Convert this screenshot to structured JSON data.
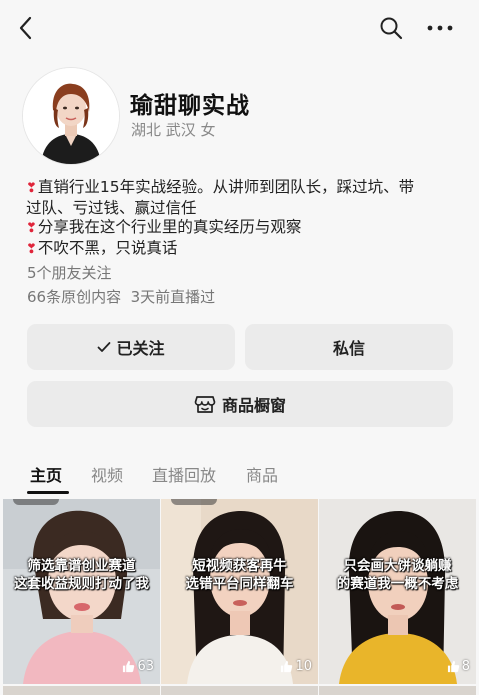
{
  "profile": {
    "name": "瑜甜聊实战",
    "location": "湖北 武汉 女",
    "bio_lines": [
      "直销行业15年实战经验。从讲师到团队长，踩过坑、带",
      "过队、亏过钱、赢过信任",
      "分享我在这个行业里的真实经历与观察",
      "不吹不黑，只说真话"
    ],
    "friends_following": "5个朋友关注",
    "stats_line": "66条原创内容  3天前直播过"
  },
  "actions": {
    "follow_label": "已关注",
    "message_label": "私信",
    "shop_label": "商品橱窗"
  },
  "tabs": [
    "主页",
    "视频",
    "直播回放",
    "商品"
  ],
  "videos": [
    {
      "caption_line1": "筛选靠谱创业赛道",
      "caption_line2": "这套收益规则打动了我",
      "likes": "63"
    },
    {
      "caption_line1": "短视频获客再牛",
      "caption_line2": "选错平台同样翻车",
      "likes": "10"
    },
    {
      "caption_line1": "只会画大饼谈躺赚",
      "caption_line2": "的赛道我一概不考虑",
      "likes": "8"
    }
  ],
  "icons": {
    "back": "chevron-left-icon",
    "search": "search-icon",
    "more": "more-icon",
    "check": "check-icon",
    "shop": "shop-icon",
    "like": "thumbs-up-icon",
    "heart": "heart-exclamation-icon"
  },
  "colors": {
    "background": "#f7f7f7",
    "button": "#ebebeb",
    "heart": "#e0243a"
  }
}
